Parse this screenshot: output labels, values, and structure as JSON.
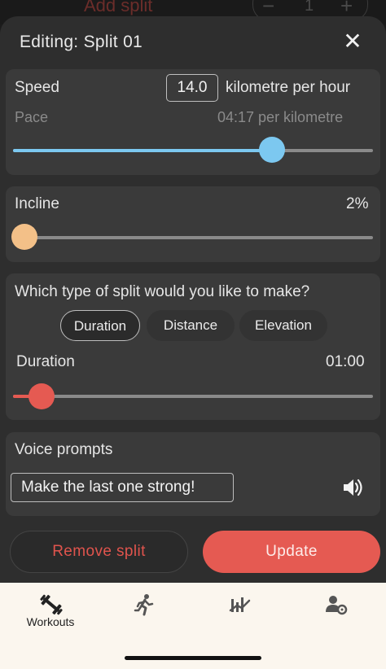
{
  "background_screen": {
    "add_split_label": "Add split",
    "count": "1",
    "minus_symbol": "−",
    "plus_symbol": "+"
  },
  "sheet": {
    "title": "Editing: Split 01",
    "close_icon": "close-icon"
  },
  "speed": {
    "label": "Speed",
    "value": "14.0",
    "unit": "kilometre per hour",
    "pace_label": "Pace",
    "pace_value": "04:17 per kilometre",
    "slider_fraction": 0.72,
    "color": "#7cc8f0"
  },
  "incline": {
    "label": "Incline",
    "value": "2%",
    "slider_fraction": 0.0,
    "color": "#f3c088"
  },
  "split_type": {
    "question": "Which type of split would you like to make?",
    "options": [
      "Duration",
      "Distance",
      "Elevation"
    ],
    "selected": "Duration",
    "duration_label": "Duration",
    "duration_value": "01:00",
    "slider_fraction": 0.08,
    "color": "#e55a52"
  },
  "voice": {
    "label": "Voice prompts",
    "prompt_text": "Make the last one strong!",
    "speaker_icon": "speaker-icon"
  },
  "actions": {
    "remove_label": "Remove split",
    "update_label": "Update"
  },
  "nav": {
    "items": [
      {
        "label": "Workouts",
        "icon": "dumbbell-icon",
        "active": true
      },
      {
        "label": "",
        "icon": "runner-icon",
        "active": false
      },
      {
        "label": "",
        "icon": "chart-icon",
        "active": false
      },
      {
        "label": "",
        "icon": "user-settings-icon",
        "active": false
      }
    ]
  }
}
